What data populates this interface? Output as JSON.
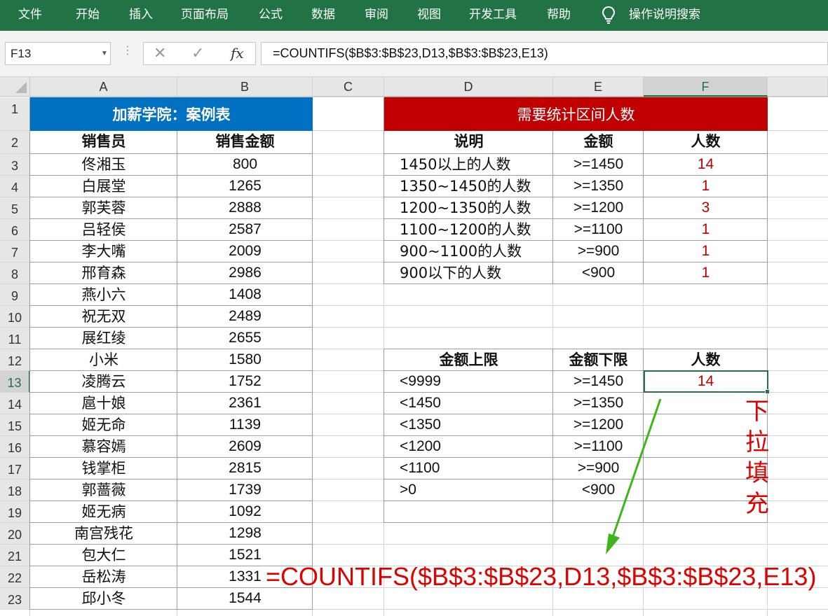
{
  "ribbon": {
    "tabs": [
      "文件",
      "开始",
      "插入",
      "页面布局",
      "公式",
      "数据",
      "审阅",
      "视图",
      "开发工具",
      "帮助"
    ],
    "search_label": "操作说明搜索",
    "color": "#217346"
  },
  "formula_bar": {
    "name_box": "F13",
    "cancel_symbol": "✕",
    "enter_symbol": "✓",
    "fx_symbol": "fx",
    "formula": "=COUNTIFS($B$3:$B$23,D13,$B$3:$B$23,E13)"
  },
  "columns": [
    "A",
    "B",
    "C",
    "D",
    "E",
    "F"
  ],
  "rows": [
    "1",
    "2",
    "3",
    "4",
    "5",
    "6",
    "7",
    "8",
    "9",
    "10",
    "11",
    "12",
    "13",
    "14",
    "15",
    "16",
    "17",
    "18",
    "19",
    "20",
    "21",
    "22",
    "23"
  ],
  "left_table": {
    "title": "加薪学院：案例表",
    "title_color": "#0070c0",
    "headers": [
      "销售员",
      "销售金额"
    ],
    "rows": [
      [
        "佟湘玉",
        "800"
      ],
      [
        "白展堂",
        "1265"
      ],
      [
        "郭芙蓉",
        "2888"
      ],
      [
        "吕轻侯",
        "2587"
      ],
      [
        "李大嘴",
        "2009"
      ],
      [
        "邢育森",
        "2986"
      ],
      [
        "燕小六",
        "1408"
      ],
      [
        "祝无双",
        "2489"
      ],
      [
        "展红绫",
        "2655"
      ],
      [
        "小米",
        "1580"
      ],
      [
        "凌腾云",
        "1752"
      ],
      [
        "扈十娘",
        "2361"
      ],
      [
        "姬无命",
        "1139"
      ],
      [
        "慕容嫣",
        "2609"
      ],
      [
        "钱掌柜",
        "2815"
      ],
      [
        "郭蔷薇",
        "1739"
      ],
      [
        "姬无病",
        "1092"
      ],
      [
        "南宫残花",
        "1298"
      ],
      [
        "包大仁",
        "1521"
      ],
      [
        "岳松涛",
        "1331"
      ],
      [
        "邱小冬",
        "1544"
      ]
    ]
  },
  "right_table_1": {
    "title": "需要统计区间人数",
    "title_color": "#c00000",
    "headers": [
      "说明",
      "金额",
      "人数"
    ],
    "rows": [
      [
        "1450以上的人数",
        ">=1450",
        "14"
      ],
      [
        "1350~1450的人数",
        ">=1350",
        "1"
      ],
      [
        "1200~1350的人数",
        ">=1200",
        "3"
      ],
      [
        "1100~1200的人数",
        ">=1100",
        "1"
      ],
      [
        "900~1100的人数",
        ">=900",
        "1"
      ],
      [
        "900以下的人数",
        "<900",
        "1"
      ]
    ]
  },
  "right_table_2": {
    "headers": [
      "金额上限",
      "金额下限",
      "人数"
    ],
    "rows": [
      [
        "<9999",
        ">=1450",
        "14"
      ],
      [
        "<1450",
        ">=1350",
        ""
      ],
      [
        "<1350",
        ">=1200",
        ""
      ],
      [
        "<1200",
        ">=1100",
        ""
      ],
      [
        "<1100",
        ">=900",
        ""
      ],
      [
        ">0",
        "<900",
        ""
      ],
      [
        "",
        "",
        ""
      ]
    ]
  },
  "annotations": {
    "vertical_note": [
      "下",
      "拉",
      "填",
      "充"
    ],
    "formula_note": "=COUNTIFS($B$3:$B$23,D13,$B$3:$B$23,E13)",
    "note_color": "#e00000",
    "arrow_color": "#3cb61a"
  }
}
